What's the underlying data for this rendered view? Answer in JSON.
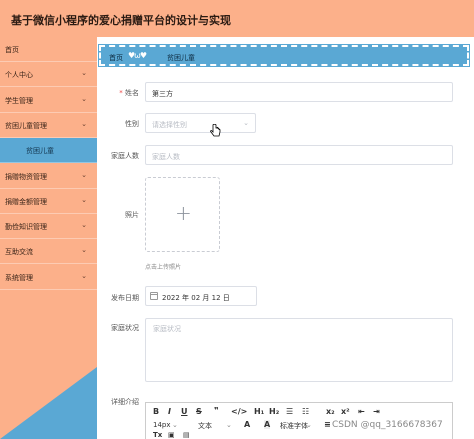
{
  "app": {
    "title": "基于微信小程序的爱心捐赠平台的设计与实现"
  },
  "colors": {
    "header": "#fcb08a",
    "accent": "#5aa8d4"
  },
  "sidebar": {
    "items": [
      {
        "label": "首页",
        "chevron": false
      },
      {
        "label": "个人中心",
        "chevron": true
      },
      {
        "label": "学生管理",
        "chevron": true
      },
      {
        "label": "贫困儿童管理",
        "chevron": true
      },
      {
        "label": "贫困儿童",
        "chevron": false,
        "sub": true
      },
      {
        "label": "捐赠物资管理",
        "chevron": true
      },
      {
        "label": "捐赠金额管理",
        "chevron": true
      },
      {
        "label": "勤俭知识管理",
        "chevron": true
      },
      {
        "label": "互助交流",
        "chevron": true
      },
      {
        "label": "系统管理",
        "chevron": true
      }
    ]
  },
  "breadcrumb": {
    "home": "首页",
    "current": "贫困儿童",
    "hearts": "♥ω♥"
  },
  "form": {
    "name": {
      "label": "姓名",
      "required": "*",
      "value": "第三方"
    },
    "gender": {
      "label": "性别",
      "placeholder": "请选择性别"
    },
    "family_count": {
      "label": "家庭人数",
      "placeholder": "家庭人数"
    },
    "photo": {
      "label": "照片",
      "tip": "点击上传照片"
    },
    "publish_date": {
      "label": "发布日期",
      "value": "2022 年 02 月 12 日"
    },
    "family_status": {
      "label": "家庭状况",
      "placeholder": "家庭状况"
    },
    "detail": {
      "label": "详细介绍"
    }
  },
  "editor": {
    "font_size": "14px",
    "text_style": "文本",
    "font_family": "标准字体"
  },
  "watermark": "CSDN @qq_3166678367"
}
